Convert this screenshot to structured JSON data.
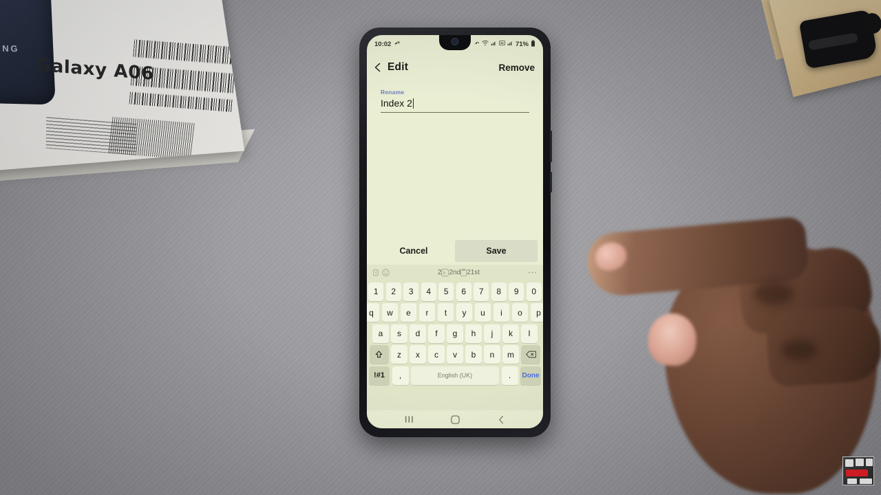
{
  "scene": {
    "description": "Samsung Galaxy A06 phone on a grey desk showing the Edit/Rename screen with keyboard open, a hand approaching from the right",
    "desk_color": "#9b9ba0"
  },
  "product_box": {
    "brand": "SAMSUNG",
    "model": "Galaxy A06"
  },
  "phone": {
    "status_bar": {
      "time": "10:02",
      "battery_percent": "71%",
      "icons": [
        "call-mute-icon",
        "wifi-icon",
        "signal-bars-icon",
        "sim-icon",
        "signal-bars-2-icon",
        "battery-icon"
      ]
    },
    "app_bar": {
      "back_icon": "chevron-left-icon",
      "title": "Edit",
      "action_label": "Remove"
    },
    "form": {
      "field_label": "Rename",
      "field_value": "Index 2",
      "cursor_visible": true
    },
    "dialog_actions": {
      "cancel_label": "Cancel",
      "save_label": "Save",
      "save_highlighted": true
    },
    "keyboard": {
      "suggestion_bar": {
        "left_icons": [
          "keyboard-expand-icon",
          "emoji-icon"
        ],
        "suggestions": [
          "2",
          "2nd",
          "21st"
        ],
        "sticker_icon": "sticker-icon",
        "clipboard_icon": "clipboard-icon",
        "more_icon": "more-options-icon"
      },
      "row_numbers": [
        "1",
        "2",
        "3",
        "4",
        "5",
        "6",
        "7",
        "8",
        "9",
        "0"
      ],
      "row_qwerty": [
        "q",
        "w",
        "e",
        "r",
        "t",
        "y",
        "u",
        "i",
        "o",
        "p"
      ],
      "row_asdf": [
        "a",
        "s",
        "d",
        "f",
        "g",
        "h",
        "j",
        "k",
        "l"
      ],
      "row_zxcv": [
        "z",
        "x",
        "c",
        "v",
        "b",
        "n",
        "m"
      ],
      "shift_icon": "shift-arrow-icon",
      "backspace_icon": "backspace-icon",
      "bottom_row": {
        "symbols_label": "!#1",
        "comma_label": ",",
        "space_label": "English (UK)",
        "period_label": ".",
        "done_label": "Done",
        "done_color": "#4b6ddb"
      }
    },
    "nav_bar": {
      "recents_icon": "recents-icon",
      "home_icon": "home-icon",
      "back_icon": "back-icon"
    },
    "screen_color": "#eaeed3",
    "keyboard_color": "#e1e5c8"
  },
  "watermark": {
    "label": "logo-watermark"
  }
}
